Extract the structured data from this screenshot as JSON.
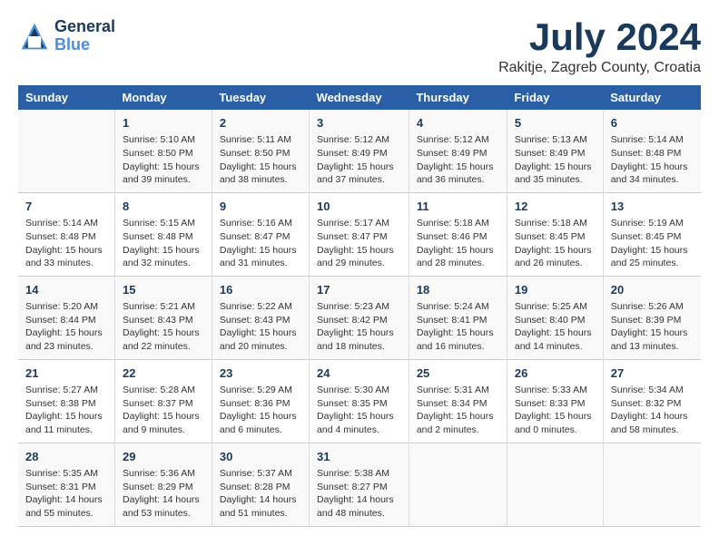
{
  "header": {
    "logo_general": "General",
    "logo_blue": "Blue",
    "month_year": "July 2024",
    "location": "Rakitje, Zagreb County, Croatia"
  },
  "calendar": {
    "days_of_week": [
      "Sunday",
      "Monday",
      "Tuesday",
      "Wednesday",
      "Thursday",
      "Friday",
      "Saturday"
    ],
    "weeks": [
      [
        {
          "day": "",
          "info": ""
        },
        {
          "day": "1",
          "info": "Sunrise: 5:10 AM\nSunset: 8:50 PM\nDaylight: 15 hours\nand 39 minutes."
        },
        {
          "day": "2",
          "info": "Sunrise: 5:11 AM\nSunset: 8:50 PM\nDaylight: 15 hours\nand 38 minutes."
        },
        {
          "day": "3",
          "info": "Sunrise: 5:12 AM\nSunset: 8:49 PM\nDaylight: 15 hours\nand 37 minutes."
        },
        {
          "day": "4",
          "info": "Sunrise: 5:12 AM\nSunset: 8:49 PM\nDaylight: 15 hours\nand 36 minutes."
        },
        {
          "day": "5",
          "info": "Sunrise: 5:13 AM\nSunset: 8:49 PM\nDaylight: 15 hours\nand 35 minutes."
        },
        {
          "day": "6",
          "info": "Sunrise: 5:14 AM\nSunset: 8:48 PM\nDaylight: 15 hours\nand 34 minutes."
        }
      ],
      [
        {
          "day": "7",
          "info": "Sunrise: 5:14 AM\nSunset: 8:48 PM\nDaylight: 15 hours\nand 33 minutes."
        },
        {
          "day": "8",
          "info": "Sunrise: 5:15 AM\nSunset: 8:48 PM\nDaylight: 15 hours\nand 32 minutes."
        },
        {
          "day": "9",
          "info": "Sunrise: 5:16 AM\nSunset: 8:47 PM\nDaylight: 15 hours\nand 31 minutes."
        },
        {
          "day": "10",
          "info": "Sunrise: 5:17 AM\nSunset: 8:47 PM\nDaylight: 15 hours\nand 29 minutes."
        },
        {
          "day": "11",
          "info": "Sunrise: 5:18 AM\nSunset: 8:46 PM\nDaylight: 15 hours\nand 28 minutes."
        },
        {
          "day": "12",
          "info": "Sunrise: 5:18 AM\nSunset: 8:45 PM\nDaylight: 15 hours\nand 26 minutes."
        },
        {
          "day": "13",
          "info": "Sunrise: 5:19 AM\nSunset: 8:45 PM\nDaylight: 15 hours\nand 25 minutes."
        }
      ],
      [
        {
          "day": "14",
          "info": "Sunrise: 5:20 AM\nSunset: 8:44 PM\nDaylight: 15 hours\nand 23 minutes."
        },
        {
          "day": "15",
          "info": "Sunrise: 5:21 AM\nSunset: 8:43 PM\nDaylight: 15 hours\nand 22 minutes."
        },
        {
          "day": "16",
          "info": "Sunrise: 5:22 AM\nSunset: 8:43 PM\nDaylight: 15 hours\nand 20 minutes."
        },
        {
          "day": "17",
          "info": "Sunrise: 5:23 AM\nSunset: 8:42 PM\nDaylight: 15 hours\nand 18 minutes."
        },
        {
          "day": "18",
          "info": "Sunrise: 5:24 AM\nSunset: 8:41 PM\nDaylight: 15 hours\nand 16 minutes."
        },
        {
          "day": "19",
          "info": "Sunrise: 5:25 AM\nSunset: 8:40 PM\nDaylight: 15 hours\nand 14 minutes."
        },
        {
          "day": "20",
          "info": "Sunrise: 5:26 AM\nSunset: 8:39 PM\nDaylight: 15 hours\nand 13 minutes."
        }
      ],
      [
        {
          "day": "21",
          "info": "Sunrise: 5:27 AM\nSunset: 8:38 PM\nDaylight: 15 hours\nand 11 minutes."
        },
        {
          "day": "22",
          "info": "Sunrise: 5:28 AM\nSunset: 8:37 PM\nDaylight: 15 hours\nand 9 minutes."
        },
        {
          "day": "23",
          "info": "Sunrise: 5:29 AM\nSunset: 8:36 PM\nDaylight: 15 hours\nand 6 minutes."
        },
        {
          "day": "24",
          "info": "Sunrise: 5:30 AM\nSunset: 8:35 PM\nDaylight: 15 hours\nand 4 minutes."
        },
        {
          "day": "25",
          "info": "Sunrise: 5:31 AM\nSunset: 8:34 PM\nDaylight: 15 hours\nand 2 minutes."
        },
        {
          "day": "26",
          "info": "Sunrise: 5:33 AM\nSunset: 8:33 PM\nDaylight: 15 hours\nand 0 minutes."
        },
        {
          "day": "27",
          "info": "Sunrise: 5:34 AM\nSunset: 8:32 PM\nDaylight: 14 hours\nand 58 minutes."
        }
      ],
      [
        {
          "day": "28",
          "info": "Sunrise: 5:35 AM\nSunset: 8:31 PM\nDaylight: 14 hours\nand 55 minutes."
        },
        {
          "day": "29",
          "info": "Sunrise: 5:36 AM\nSunset: 8:29 PM\nDaylight: 14 hours\nand 53 minutes."
        },
        {
          "day": "30",
          "info": "Sunrise: 5:37 AM\nSunset: 8:28 PM\nDaylight: 14 hours\nand 51 minutes."
        },
        {
          "day": "31",
          "info": "Sunrise: 5:38 AM\nSunset: 8:27 PM\nDaylight: 14 hours\nand 48 minutes."
        },
        {
          "day": "",
          "info": ""
        },
        {
          "day": "",
          "info": ""
        },
        {
          "day": "",
          "info": ""
        }
      ]
    ]
  }
}
